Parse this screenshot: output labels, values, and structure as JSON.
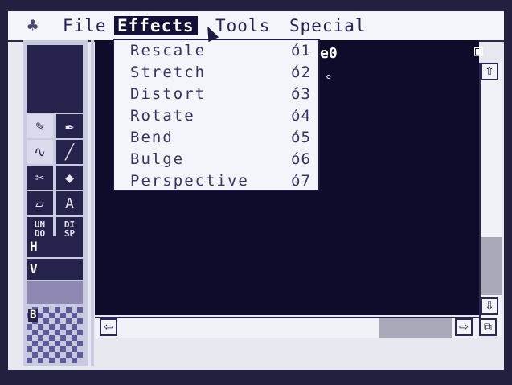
{
  "menubar": {
    "apple": "♣",
    "items": [
      "File",
      "Effects",
      "Tools",
      "Special"
    ]
  },
  "effects_menu": {
    "items": [
      {
        "label": "Rescale",
        "shortcut": "ó1"
      },
      {
        "label": "Stretch",
        "shortcut": "ó2"
      },
      {
        "label": "Distort",
        "shortcut": "ó3"
      },
      {
        "label": "Rotate",
        "shortcut": "ó4"
      },
      {
        "label": "Bend",
        "shortcut": "ó5"
      },
      {
        "label": "Bulge",
        "shortcut": "ó6"
      },
      {
        "label": "Perspective",
        "shortcut": "ó7"
      }
    ]
  },
  "window": {
    "title_fragment": "e0",
    "dot": "°"
  },
  "tools": {
    "text": "A",
    "undo": "UN DO",
    "disp": "DI SP",
    "h": "H",
    "v": "V",
    "pattern": "B"
  },
  "icons": {
    "pencil": "✎",
    "brush": "✒",
    "curve": "∿",
    "line": "╱",
    "scissors": "✂",
    "fill": "◆",
    "eraser": "▱",
    "up": "⇧",
    "down": "⇩",
    "left": "⇦",
    "right": "⇨",
    "resize": "⧉"
  },
  "colors": {
    "canvas": "#0e0c2b",
    "menubar": "#f4f5fb",
    "accent": "#121038"
  }
}
